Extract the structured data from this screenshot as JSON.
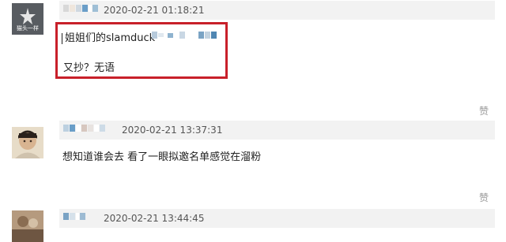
{
  "comments": [
    {
      "avatar_caption": "猫头一样",
      "timestamp": "2020-02-21 01:18:21",
      "lines": [
        "姐姐们的slamduck",
        "又抄？无语"
      ],
      "like_label": "赞"
    },
    {
      "timestamp": "2020-02-21 13:37:31",
      "lines": [
        "想知道谁会去  看了一眼拟邀名单感觉在溜粉"
      ],
      "like_label": "赞"
    },
    {
      "timestamp": "2020-02-21 13:44:45"
    }
  ],
  "colors": {
    "highlight": "#c8202a",
    "header_bar": "#f2f2f2",
    "mosaic_blue": "#6a9ec8"
  }
}
